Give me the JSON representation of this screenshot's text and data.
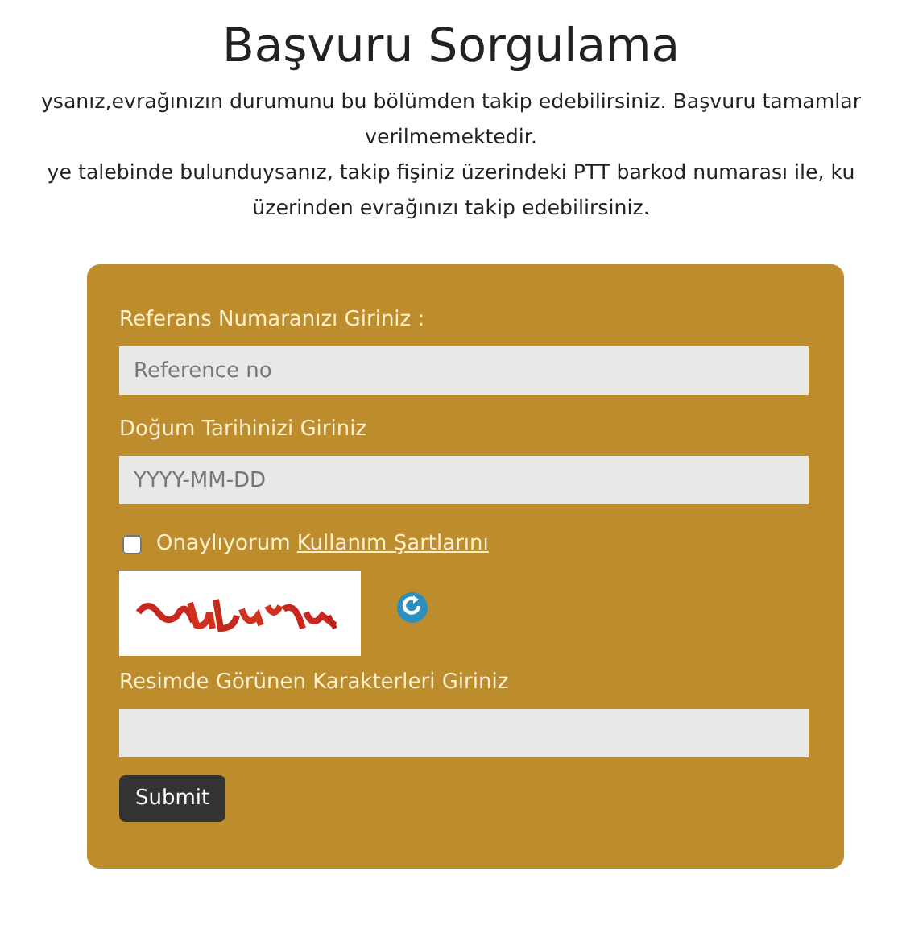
{
  "title": "Başvuru Sorgulama",
  "intro_lines": [
    "ysanız,evrağınızın durumunu bu bölümden takip edebilirsiniz. Başvuru tamamlar",
    "verilmemektedir.",
    "ye talebinde bulunduysanız, takip fişiniz üzerindeki PTT barkod numarası ile, ku",
    "üzerinden evrağınızı takip edebilirsiniz."
  ],
  "form": {
    "reference": {
      "label": "Referans Numaranızı Giriniz :",
      "placeholder": "Reference no"
    },
    "birth_date": {
      "label": "Doğum Tarihinizi Giriniz",
      "placeholder": "YYYY-MM-DD"
    },
    "terms": {
      "checked": false,
      "label": "Onaylıyorum",
      "link": "Kullanım Şartlarını"
    },
    "captcha_input": {
      "label": "Resimde Görünen Karakterleri Giriniz"
    },
    "submit": "Submit"
  }
}
